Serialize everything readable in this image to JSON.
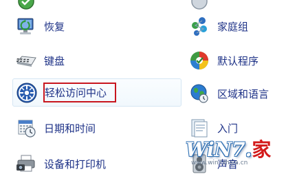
{
  "left_column": [
    {
      "label": "",
      "icon": "partial-top-icon"
    },
    {
      "label": "恢复",
      "icon": "recovery-computer-icon"
    },
    {
      "label": "键盘",
      "icon": "keyboard-icon"
    },
    {
      "label": "轻松访问中心",
      "icon": "ease-of-access-icon"
    },
    {
      "label": "日期和时间",
      "icon": "calendar-clock-icon"
    },
    {
      "label": "设备和打印机",
      "icon": "printer-camera-icon"
    }
  ],
  "right_column": [
    {
      "label": "",
      "icon": "partial-top-icon"
    },
    {
      "label": "家庭组",
      "icon": "homegroup-icon"
    },
    {
      "label": "默认程序",
      "icon": "default-programs-icon"
    },
    {
      "label": "区域和语言",
      "icon": "region-language-icon"
    },
    {
      "label": "入门",
      "icon": "getting-started-icon"
    },
    {
      "label": "声音",
      "icon": "sound-speaker-icon"
    }
  ],
  "watermark": {
    "main_text": "WiN7.",
    "main_suffix": "家",
    "url": "www.win7zhijia.cn"
  },
  "colors": {
    "link_text": "#1e3287",
    "highlight_border": "#c8151d",
    "hover_bg": "#f1f8fd"
  }
}
